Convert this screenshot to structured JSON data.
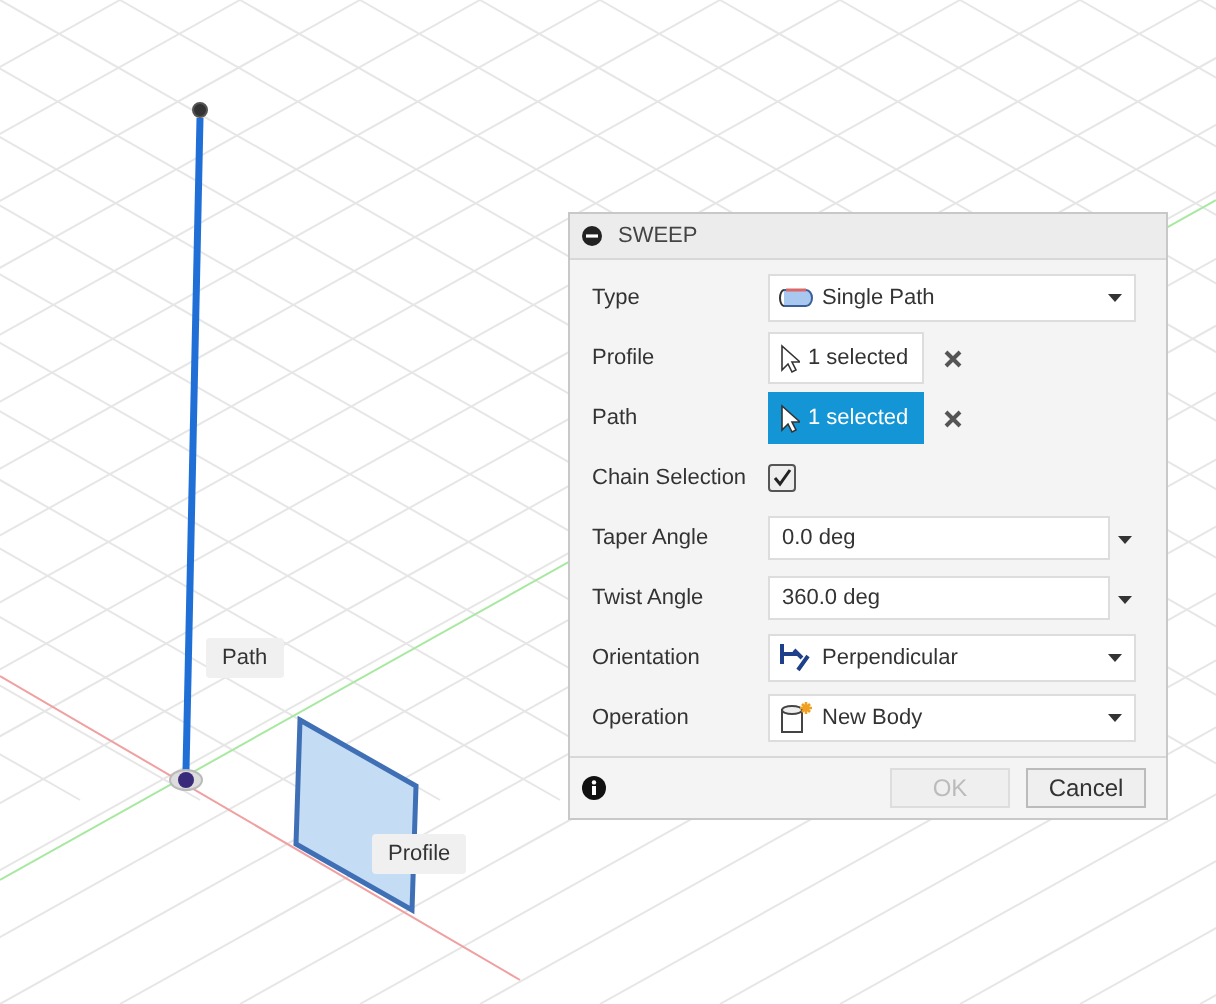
{
  "viewport": {
    "labels": [
      {
        "kind": "path",
        "text": "Path"
      },
      {
        "kind": "profile",
        "text": "Profile"
      }
    ]
  },
  "dialog": {
    "title": "SWEEP",
    "rows": [
      {
        "kind": "dropdown",
        "label": "Type",
        "value": "Single Path"
      },
      {
        "kind": "selection",
        "label": "Profile",
        "value": "1 selected",
        "selected": false
      },
      {
        "kind": "selection",
        "label": "Path",
        "value": "1 selected",
        "selected": true
      },
      {
        "kind": "checkbox",
        "label": "Chain Selection",
        "checked": true
      },
      {
        "kind": "number",
        "label": "Taper Angle",
        "value": "0.0 deg"
      },
      {
        "kind": "number",
        "label": "Twist Angle",
        "value": "360.0 deg"
      },
      {
        "kind": "dropdown",
        "label": "Orientation",
        "value": "Perpendicular"
      },
      {
        "kind": "dropdown",
        "label": "Operation",
        "value": "New Body"
      }
    ],
    "buttons": [
      {
        "label": "OK",
        "disabled": true
      },
      {
        "label": "Cancel",
        "disabled": false
      }
    ]
  }
}
